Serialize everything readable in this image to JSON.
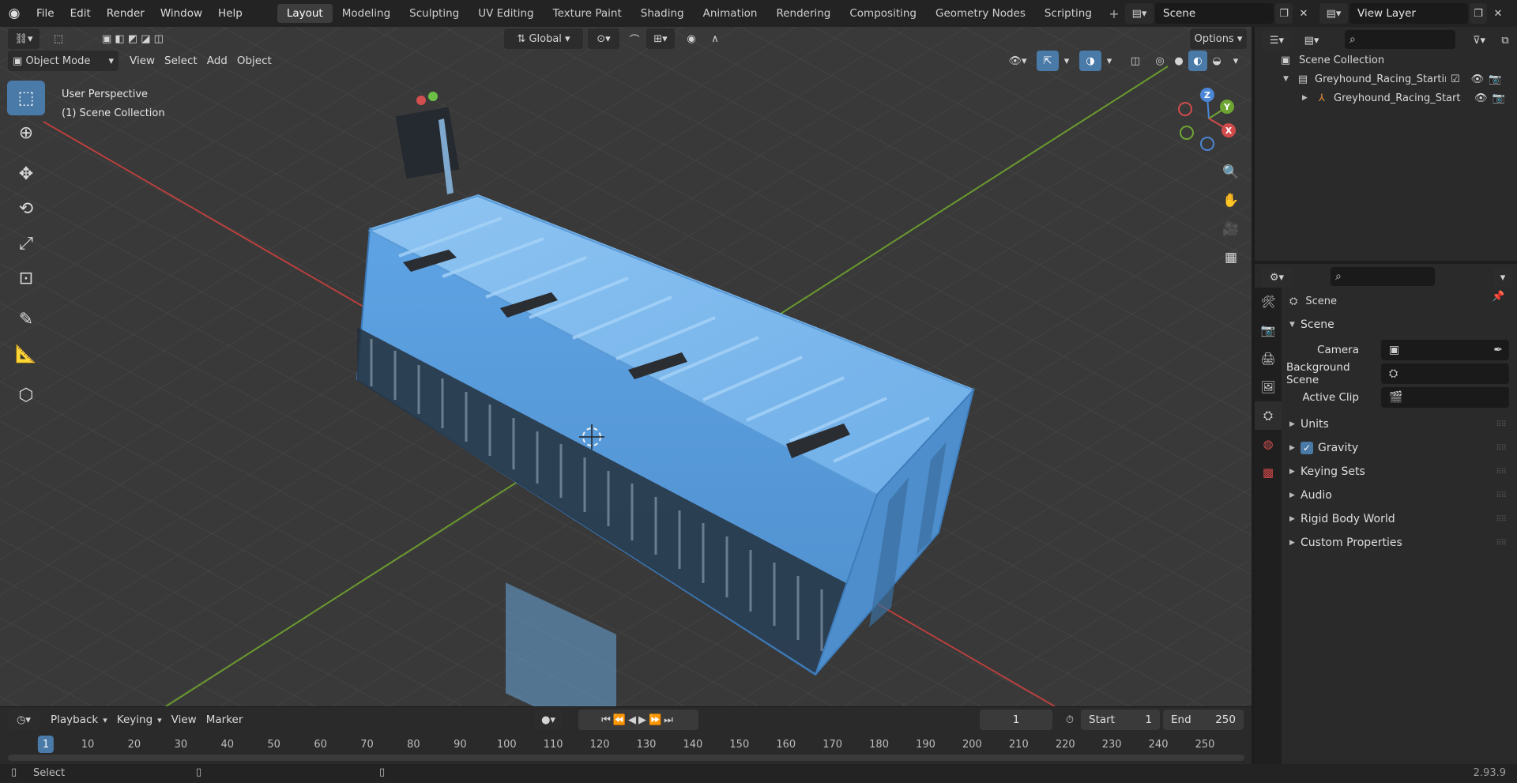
{
  "menu": [
    "File",
    "Edit",
    "Render",
    "Window",
    "Help"
  ],
  "workspaces": [
    "Layout",
    "Modeling",
    "Sculpting",
    "UV Editing",
    "Texture Paint",
    "Shading",
    "Animation",
    "Rendering",
    "Compositing",
    "Geometry Nodes",
    "Scripting"
  ],
  "scene_name": "Scene",
  "view_layer": "View Layer",
  "viewport": {
    "transform_orientation": "Global",
    "options_label": "Options",
    "mode": "Object Mode",
    "header_menus": [
      "View",
      "Select",
      "Add",
      "Object"
    ],
    "info_line1": "User Perspective",
    "info_line2": "(1) Scene Collection",
    "gizmo_axes": {
      "z": "Z",
      "y": "Y",
      "x": "X"
    }
  },
  "outliner": {
    "root": "Scene Collection",
    "collection": "Greyhound_Racing_Starting_E",
    "object": "Greyhound_Racing_Start"
  },
  "properties": {
    "context": "Scene",
    "section": "Scene",
    "fields": [
      {
        "label": "Camera",
        "value": ""
      },
      {
        "label": "Background Scene",
        "value": ""
      },
      {
        "label": "Active Clip",
        "value": ""
      }
    ],
    "panels": [
      "Units",
      "Gravity",
      "Keying Sets",
      "Audio",
      "Rigid Body World",
      "Custom Properties"
    ],
    "gravity_checked": true
  },
  "timeline": {
    "menus": [
      "Playback",
      "Keying",
      "View",
      "Marker"
    ],
    "current_frame": "1",
    "start_label": "Start",
    "start": "1",
    "end_label": "End",
    "end": "250",
    "ticks": [
      "1",
      "10",
      "20",
      "30",
      "40",
      "50",
      "60",
      "70",
      "80",
      "90",
      "100",
      "110",
      "120",
      "130",
      "140",
      "150",
      "160",
      "170",
      "180",
      "190",
      "200",
      "210",
      "220",
      "230",
      "240",
      "250"
    ]
  },
  "status": {
    "select": "Select",
    "version": "2.93.9"
  },
  "colors": {
    "accent": "#4a7aa8",
    "x_axis": "#c0403f",
    "y_axis": "#6a9e2f",
    "object": "#5aa0e8"
  }
}
